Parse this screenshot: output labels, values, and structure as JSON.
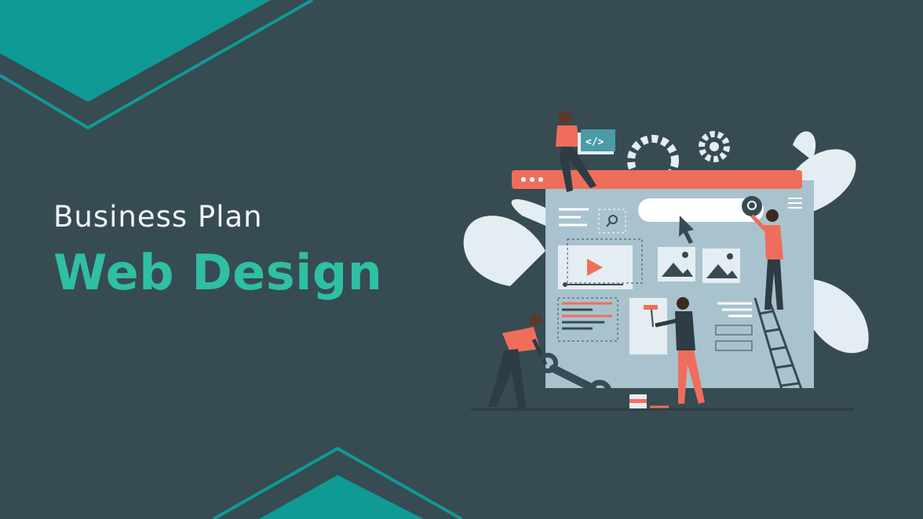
{
  "slide": {
    "subtitle": "Business Plan",
    "headline": "Web Design"
  },
  "illustration": {
    "code_tag": "</>",
    "description_icons": [
      "gear-icon",
      "search-icon",
      "play-icon",
      "image-icon",
      "menu-icon",
      "cursor-icon",
      "wrench-icon",
      "paint-roller-icon",
      "ladder-icon",
      "leaf-icon"
    ]
  },
  "colors": {
    "background": "#374b52",
    "accent_teal": "#0f9a95",
    "headline": "#2fbfa2",
    "coral": "#ef6e5b",
    "browser_panel": "#a9c3ce"
  }
}
